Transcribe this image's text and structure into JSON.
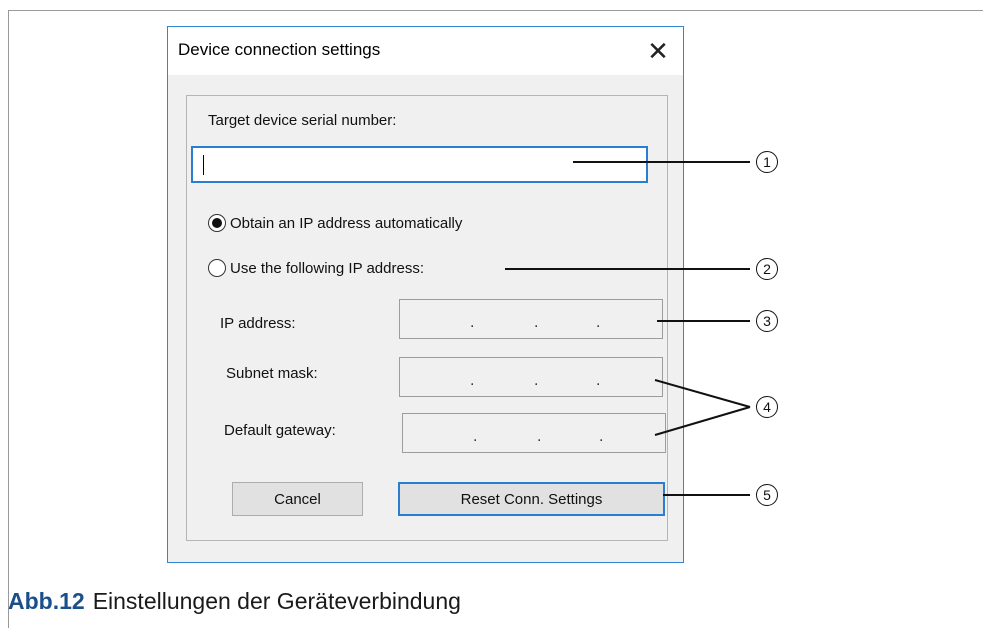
{
  "dialog": {
    "title": "Device connection settings",
    "close_glyph": "✕",
    "serial_label": "Target device serial number:",
    "serial_value": "",
    "radio_auto": "Obtain an IP address automatically",
    "radio_manual": "Use the following IP address:",
    "ip_label": "IP address:",
    "subnet_label": "Subnet mask:",
    "gateway_label": "Default gateway:",
    "ip_dot": ".",
    "cancel_label": "Cancel",
    "reset_label": "Reset Conn. Settings",
    "selected_radio": "auto"
  },
  "callouts": [
    "1",
    "2",
    "3",
    "4",
    "5"
  ],
  "caption": {
    "number": "Abb.12",
    "text": "Einstellungen der Geräteverbindung"
  },
  "colors": {
    "accent": "#2a7ed1",
    "caption_number": "#1a4f8b"
  }
}
